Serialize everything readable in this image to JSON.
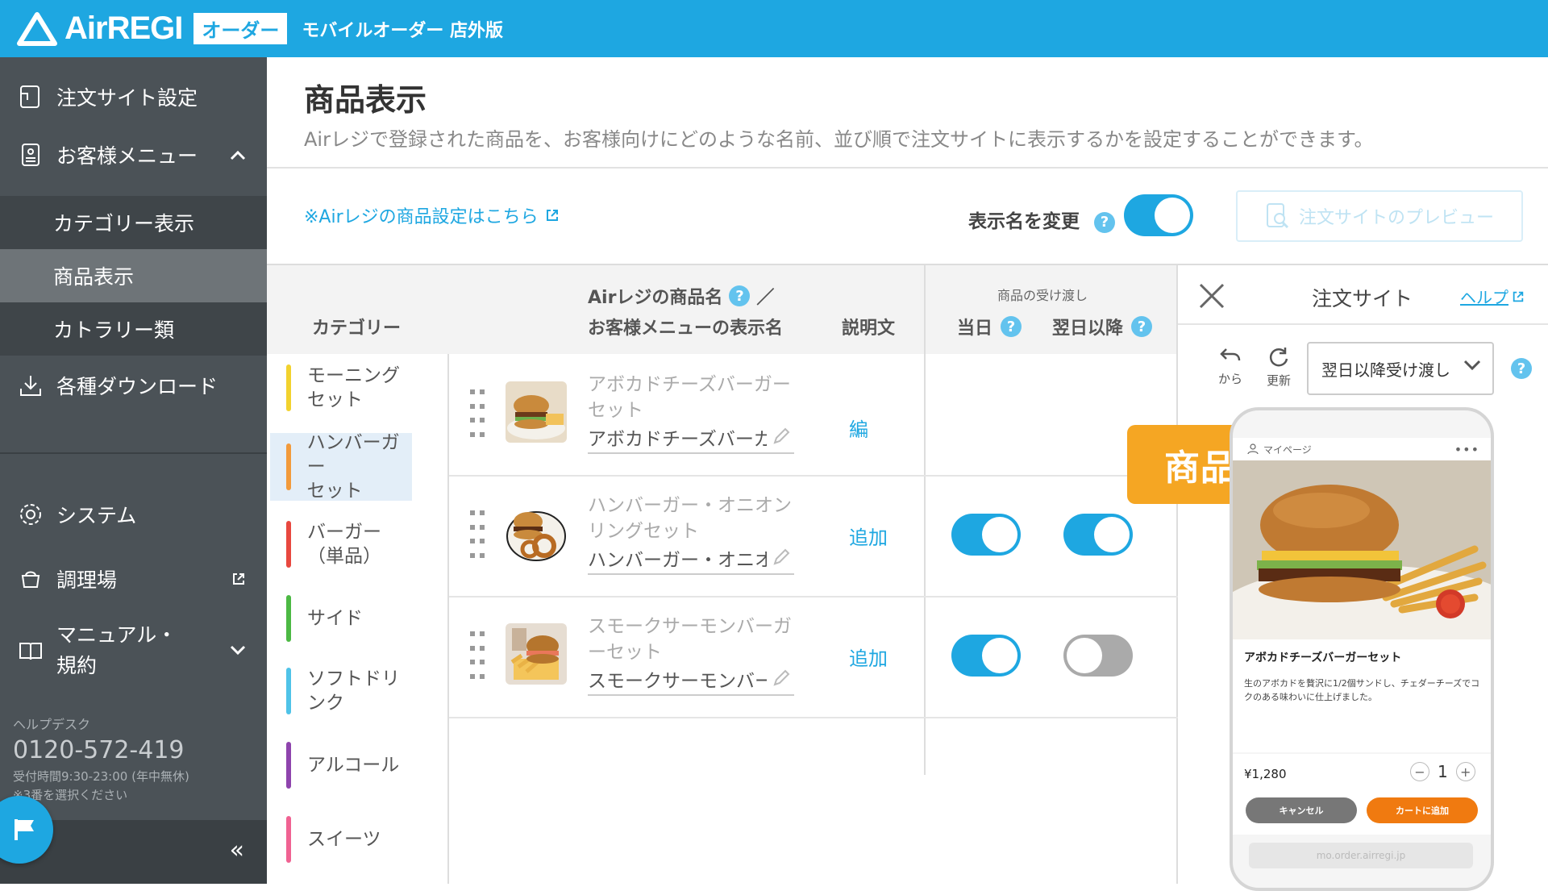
{
  "app": {
    "logo_text": "AirREGI",
    "logo_badge": "オーダー",
    "subtitle": "モバイルオーダー 店外版"
  },
  "sidebar": {
    "items": [
      {
        "label": "注文サイト設定",
        "icon": "order-site-icon"
      },
      {
        "label": "お客様メニュー",
        "icon": "customer-menu-icon"
      },
      {
        "label": "各種ダウンロード",
        "icon": "download-icon"
      },
      {
        "label": "システム",
        "icon": "gear-icon"
      },
      {
        "label": "調理場",
        "icon": "kitchen-icon"
      },
      {
        "label": "マニュアル・\n規約",
        "icon": "manual-icon"
      }
    ],
    "sub_items": [
      {
        "label": "カテゴリー表示",
        "active": false
      },
      {
        "label": "商品表示",
        "active": true
      },
      {
        "label": "カトラリー類",
        "active": false
      }
    ],
    "help": {
      "title": "ヘルプデスク",
      "phone": "0120-572-419",
      "hours": "受付時間9:30-23:00 (年中無休)",
      "note": "※3番を選択ください"
    },
    "collapse_label": "«"
  },
  "page": {
    "title": "商品表示",
    "description": "Airレジで登録された商品を、お客様向けにどのような名前、並び順で注文サイトに表示するかを設定することができます。",
    "airregi_link": "※Airレジの商品設定はこちら",
    "rename_label": "表示名を変更",
    "rename_on": true,
    "preview_button": "注文サイトのプレビュー"
  },
  "table": {
    "col_category": "カテゴリー",
    "col_name_line1": "Airレジの商品名",
    "col_name_sep": "／",
    "col_name_line2": "お客様メニューの表示名",
    "col_desc": "説明文",
    "col_handover": "商品の受け渡し",
    "col_today": "当日",
    "col_nextday": "翌日以降",
    "categories": [
      {
        "name": "モーニング\nセット",
        "color": "#f2d22e",
        "active": false
      },
      {
        "name": "ハンバーガー\nセット",
        "color": "#f29a3b",
        "active": true
      },
      {
        "name": "バーガー\n（単品）",
        "color": "#e8483f",
        "active": false
      },
      {
        "name": "サイド",
        "color": "#4cb944",
        "active": false
      },
      {
        "name": "ソフトドリ\nンク",
        "color": "#4fc3e8",
        "active": false
      },
      {
        "name": "アルコール",
        "color": "#8e44ad",
        "active": false
      },
      {
        "name": "スイーツ",
        "color": "#f06292",
        "active": false
      }
    ],
    "products": [
      {
        "airregi_name": "アボカドチーズバーガーセット",
        "display_name": "アボカドチーズバーガーセット",
        "desc_link": "編",
        "today": true,
        "nextday": true
      },
      {
        "airregi_name": "ハンバーガー・オニオンリングセット",
        "display_name": "ハンバーガー・オニオンリングセット",
        "desc_link": "追加",
        "today": true,
        "nextday": true
      },
      {
        "airregi_name": "スモークサーモンバーガーセット",
        "display_name": "スモークサーモンバーガーセット",
        "desc_link": "追加",
        "today": true,
        "nextday": false
      }
    ]
  },
  "preview_panel": {
    "title": "注文サイト",
    "help_link": "ヘルプ",
    "back_label": "から",
    "refresh_label": "更新",
    "select_value": "翌日以降受け渡し",
    "phone": {
      "topbar": "マイページ",
      "product_name": "アボカドチーズバーガーセット",
      "product_desc": "生のアボカドを贅沢に1/2個サンドし、チェダーチーズでコクのある味わいに仕上げました。",
      "price": "¥1,280",
      "qty": "1",
      "cancel": "キャンセル",
      "add_to_cart": "カートに追加",
      "url": "mo.order.airregi.jp"
    }
  },
  "callout": {
    "text": "商品ページの確認"
  },
  "colors": {
    "brand": "#1ea7e1",
    "sidebar": "#4b5257",
    "callout": "#f5a623",
    "cart_button": "#f07a10",
    "cancel_button": "#777777"
  }
}
